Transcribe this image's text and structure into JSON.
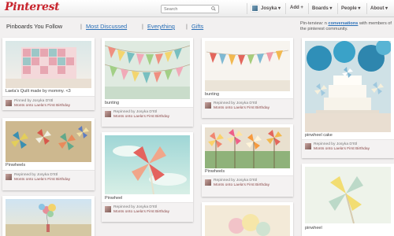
{
  "header": {
    "logo": "Pinterest",
    "search_placeholder": "Search",
    "nav": {
      "user": "Josyka",
      "add": "Add +",
      "boards": "Boards",
      "people": "People",
      "about": "About"
    }
  },
  "subnav": {
    "current": "Pinboards You Follow",
    "sep": "|",
    "most_discussed": "Most Discussed",
    "everything": "Everything",
    "gifts": "Gifts"
  },
  "promo": {
    "prefix": "Pin-terview: n",
    "link": "conversations",
    "suffix": " with members of the pinterest community."
  },
  "pins": [
    {
      "caption": "Laela's Quilt made by mommy. <3",
      "attr_who": "Pinned by Josyka D'Ittl",
      "attr_where": "Monts onto Laela's First Birthday"
    },
    {
      "caption": "Pinwheels",
      "attr_who": "Repinned by Josyka D'Ittl",
      "attr_where": "Monts onto Laela's First Birthday"
    },
    {
      "caption": "bunting",
      "attr_who": "Repinned by Josyka D'Ittl",
      "attr_where": "Monts onto Laela's First Birthday"
    },
    {
      "caption": "Pinwheel",
      "attr_who": "Repinned by Josyka D'Ittl",
      "attr_where": "Monts onto Laela's First Birthday"
    },
    {
      "caption": "bunting",
      "attr_who": "Repinned by Josyka D'Ittl",
      "attr_where": "Monts onto Laela's First Birthday"
    },
    {
      "caption": "Pinwheels",
      "attr_who": "Repinned by Josyka D'Ittl",
      "attr_where": "Monts onto Laela's First Birthday"
    },
    {
      "caption": "pinwheel cake",
      "attr_who": "Repinned by Josyka D'Ittl",
      "attr_where": "Monts onto Laela's First Birthday"
    },
    {
      "caption": "pinwheel",
      "attr_who": "",
      "attr_where": ""
    }
  ],
  "colors": {
    "brand": "#c8232c",
    "link": "#2a6fb7"
  }
}
